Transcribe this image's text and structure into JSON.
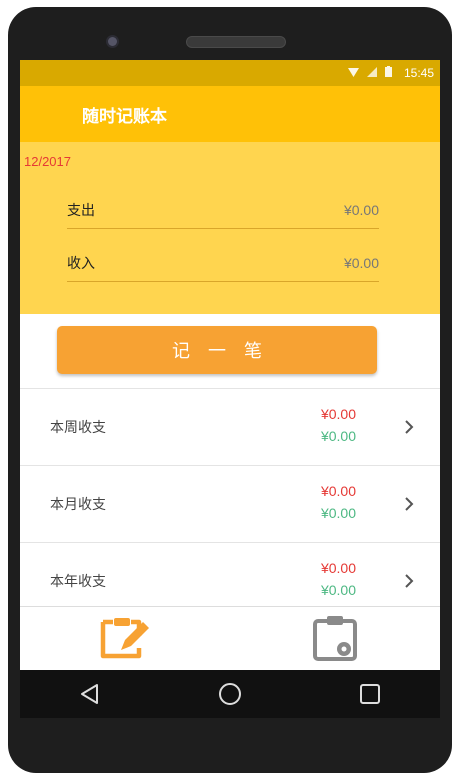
{
  "statusbar": {
    "time": "15:45",
    "icons": [
      "wifi-icon",
      "signal-icon",
      "battery-icon"
    ]
  },
  "appbar": {
    "title": "随时记账本"
  },
  "summary": {
    "date": "12/2017",
    "expense_label": "支出",
    "expense_amount": "¥0.00",
    "income_label": "收入",
    "income_amount": "¥0.00"
  },
  "record_button": {
    "label": "记一笔"
  },
  "periods": [
    {
      "label": "本周收支",
      "expense": "¥0.00",
      "income": "¥0.00"
    },
    {
      "label": "本月收支",
      "expense": "¥0.00",
      "income": "¥0.00"
    },
    {
      "label": "本年收支",
      "expense": "¥0.00",
      "income": "¥0.00"
    }
  ],
  "tabs": [
    {
      "icon": "edit-record-icon",
      "active": true
    },
    {
      "icon": "clipboard-settings-icon",
      "active": false
    }
  ],
  "nav": [
    "back-icon",
    "home-icon",
    "recents-icon"
  ],
  "colors": {
    "appbar": "#ffc107",
    "summary_bg": "#ffd54f",
    "accent": "#f7a233",
    "expense": "#e53935",
    "income": "#4db883"
  }
}
